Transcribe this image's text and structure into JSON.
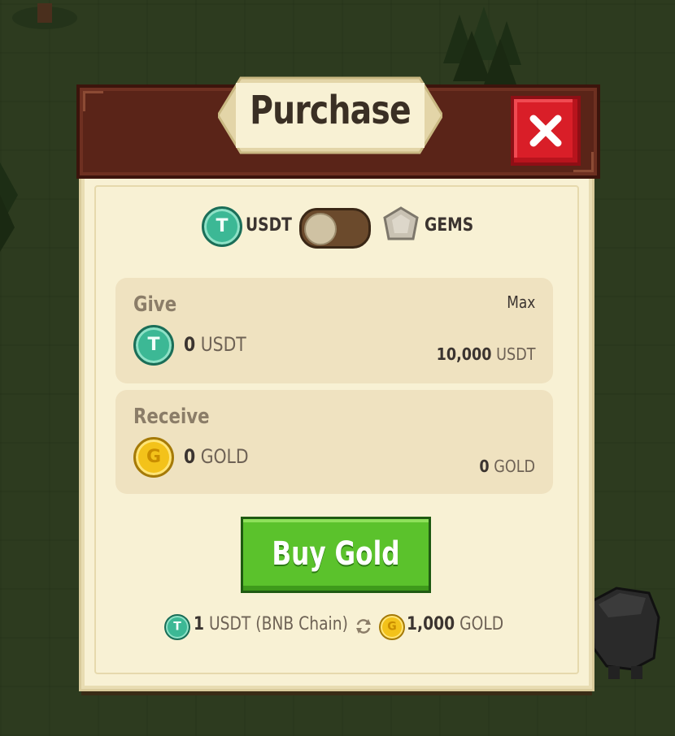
{
  "window": {
    "title": "Purchase"
  },
  "colors": {
    "header": "#5a2418",
    "panel": "#f8f1d4",
    "close": "#d91e28",
    "buy": "#5bc22c",
    "usdt": "#3cb895",
    "gold": "#f3c21a"
  },
  "toggle": {
    "left_label": "USDT",
    "right_label": "GEMS",
    "left_icon": "usdt-coin-icon",
    "right_icon": "gem-icon",
    "state": "USDT"
  },
  "give": {
    "label": "Give",
    "amount": "0",
    "unit": "USDT",
    "max_label": "Max",
    "max_value": "10,000",
    "max_unit": "USDT"
  },
  "receive": {
    "label": "Receive",
    "amount": "0",
    "unit": "GOLD",
    "value": "0",
    "value_unit": "GOLD"
  },
  "buy_button": {
    "label": "Buy Gold"
  },
  "rate": {
    "from_amount": "1",
    "from_unit": "USDT (BNB Chain)",
    "swap_icon": "exchange-icon",
    "to_amount": "1,000",
    "to_unit": "GOLD"
  }
}
